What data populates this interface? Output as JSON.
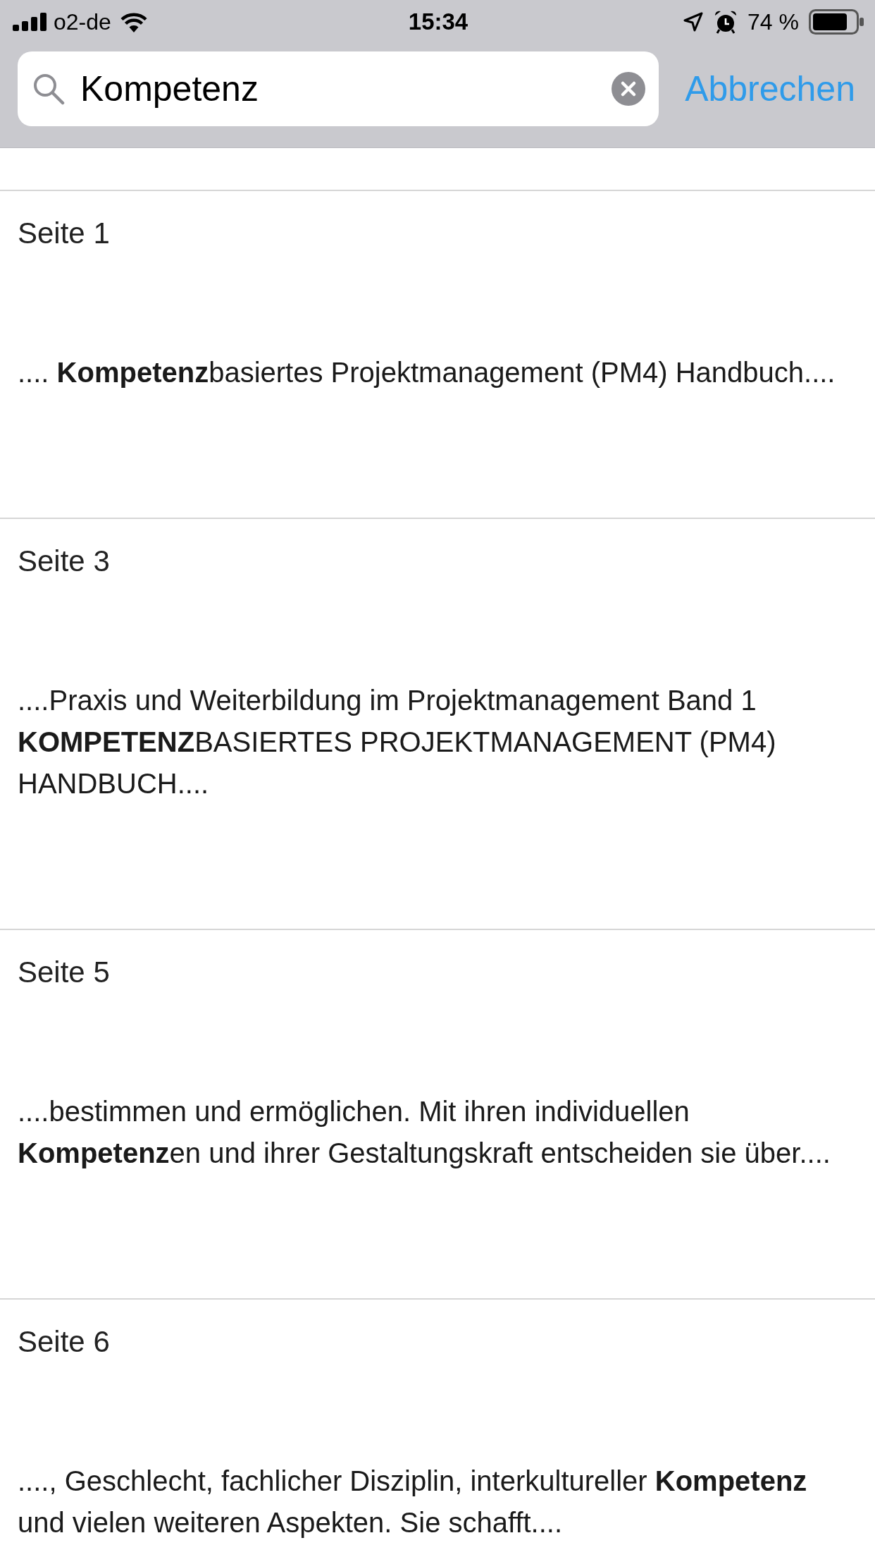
{
  "status_bar": {
    "carrier": "o2-de",
    "time": "15:34",
    "battery": "74 %"
  },
  "search": {
    "value": "Kompetenz",
    "cancel": "Abbrechen"
  },
  "results": [
    {
      "title": "Seite 1",
      "snippet": ".... **Kompetenz**basiertes Projektmanagement (PM4) Handbuch...."
    },
    {
      "title": "Seite 3",
      "snippet": "....Praxis und Weiterbildung im Projektmanagement Band 1 **KOMPETENZ**BASIERTES PROJEKTMANAGEMENT (PM4) HANDBUCH...."
    },
    {
      "title": "Seite 5",
      "snippet": "....bestimmen und ermöglichen. Mit ihren individuellen **Kompetenz**en und ihrer Gestaltungskraft entscheiden sie über...."
    },
    {
      "title": "Seite 6",
      "snippet": "...., Geschlecht, fachlicher Disziplin, interkultureller **Kompetenz** und vielen weiteren Aspekten. Sie schafft...."
    }
  ]
}
